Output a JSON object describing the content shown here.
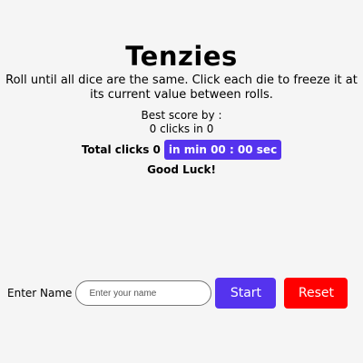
{
  "app": {
    "title": "Tenzies",
    "description": "Roll until all dice are the same. Click each die to freeze it at its current value between rolls."
  },
  "best_score": {
    "label": "Best score by :",
    "value": "0 clicks in 0"
  },
  "stats": {
    "total_clicks": "Total clicks 0",
    "timer": "in min 00 : 00 sec",
    "message": "Good Luck!"
  },
  "controls": {
    "name_label": "Enter Name",
    "name_placeholder": "Enter your name",
    "start_label": "Start",
    "reset_label": "Reset"
  },
  "colors": {
    "accent": "#5533ee",
    "reset": "#ff0000",
    "background": "#f5f5f5"
  }
}
